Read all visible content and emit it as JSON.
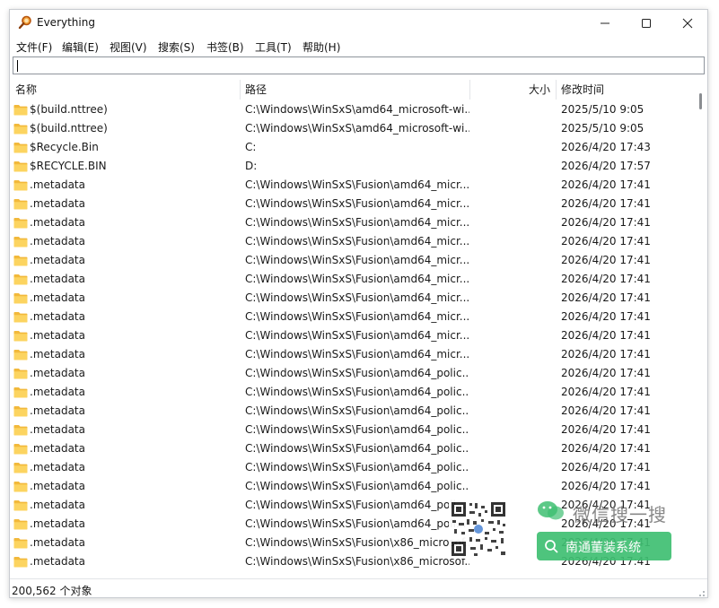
{
  "window": {
    "title": "Everything",
    "controls": [
      "minimize",
      "maximize",
      "close"
    ]
  },
  "menu": [
    "文件(F)",
    "编辑(E)",
    "视图(V)",
    "搜索(S)",
    "书签(B)",
    "工具(T)",
    "帮助(H)"
  ],
  "search": {
    "value": "",
    "placeholder": ""
  },
  "columns": {
    "name": "名称",
    "path": "路径",
    "size": "大小",
    "modified": "修改时间"
  },
  "rows": [
    {
      "name": "$(build.nttree)",
      "path": "C:\\Windows\\WinSxS\\amd64_microsoft-wi...",
      "modified": "2025/5/10 9:05"
    },
    {
      "name": "$(build.nttree)",
      "path": "C:\\Windows\\WinSxS\\amd64_microsoft-wi...",
      "modified": "2025/5/10 9:05"
    },
    {
      "name": "$Recycle.Bin",
      "path": "C:",
      "modified": "2026/4/20 17:43"
    },
    {
      "name": "$RECYCLE.BIN",
      "path": "D:",
      "modified": "2026/4/20 17:57"
    },
    {
      "name": ".metadata",
      "path": "C:\\Windows\\WinSxS\\Fusion\\amd64_micr...",
      "modified": "2026/4/20 17:41"
    },
    {
      "name": ".metadata",
      "path": "C:\\Windows\\WinSxS\\Fusion\\amd64_micr...",
      "modified": "2026/4/20 17:41"
    },
    {
      "name": ".metadata",
      "path": "C:\\Windows\\WinSxS\\Fusion\\amd64_micr...",
      "modified": "2026/4/20 17:41"
    },
    {
      "name": ".metadata",
      "path": "C:\\Windows\\WinSxS\\Fusion\\amd64_micr...",
      "modified": "2026/4/20 17:41"
    },
    {
      "name": ".metadata",
      "path": "C:\\Windows\\WinSxS\\Fusion\\amd64_micr...",
      "modified": "2026/4/20 17:41"
    },
    {
      "name": ".metadata",
      "path": "C:\\Windows\\WinSxS\\Fusion\\amd64_micr...",
      "modified": "2026/4/20 17:41"
    },
    {
      "name": ".metadata",
      "path": "C:\\Windows\\WinSxS\\Fusion\\amd64_micr...",
      "modified": "2026/4/20 17:41"
    },
    {
      "name": ".metadata",
      "path": "C:\\Windows\\WinSxS\\Fusion\\amd64_micr...",
      "modified": "2026/4/20 17:41"
    },
    {
      "name": ".metadata",
      "path": "C:\\Windows\\WinSxS\\Fusion\\amd64_micr...",
      "modified": "2026/4/20 17:41"
    },
    {
      "name": ".metadata",
      "path": "C:\\Windows\\WinSxS\\Fusion\\amd64_micr...",
      "modified": "2026/4/20 17:41"
    },
    {
      "name": ".metadata",
      "path": "C:\\Windows\\WinSxS\\Fusion\\amd64_polic...",
      "modified": "2026/4/20 17:41"
    },
    {
      "name": ".metadata",
      "path": "C:\\Windows\\WinSxS\\Fusion\\amd64_polic...",
      "modified": "2026/4/20 17:41"
    },
    {
      "name": ".metadata",
      "path": "C:\\Windows\\WinSxS\\Fusion\\amd64_polic...",
      "modified": "2026/4/20 17:41"
    },
    {
      "name": ".metadata",
      "path": "C:\\Windows\\WinSxS\\Fusion\\amd64_polic...",
      "modified": "2026/4/20 17:41"
    },
    {
      "name": ".metadata",
      "path": "C:\\Windows\\WinSxS\\Fusion\\amd64_polic...",
      "modified": "2026/4/20 17:41"
    },
    {
      "name": ".metadata",
      "path": "C:\\Windows\\WinSxS\\Fusion\\amd64_polic...",
      "modified": "2026/4/20 17:41"
    },
    {
      "name": ".metadata",
      "path": "C:\\Windows\\WinSxS\\Fusion\\amd64_polic...",
      "modified": "2026/4/20 17:41"
    },
    {
      "name": ".metadata",
      "path": "C:\\Windows\\WinSxS\\Fusion\\amd64_poli...",
      "modified": "2026/4/20 17:41"
    },
    {
      "name": ".metadata",
      "path": "C:\\Windows\\WinSxS\\Fusion\\amd64_poli...",
      "modified": "2026/4/20 17:41"
    },
    {
      "name": ".metadata",
      "path": "C:\\Windows\\WinSxS\\Fusion\\x86_microsof...",
      "modified": "2026/4/20 17:41"
    },
    {
      "name": ".metadata",
      "path": "C:\\Windows\\WinSxS\\Fusion\\x86_microsof...",
      "modified": "2026/4/20 17:41"
    }
  ],
  "status": {
    "text": "200,562 个对象"
  },
  "watermark": {
    "line1": "微信搜一搜",
    "line2": "南通董装系统"
  },
  "colors": {
    "folder": "#f7c24a",
    "accent_green": "#3fbf72",
    "app_icon": "#e2791f"
  }
}
